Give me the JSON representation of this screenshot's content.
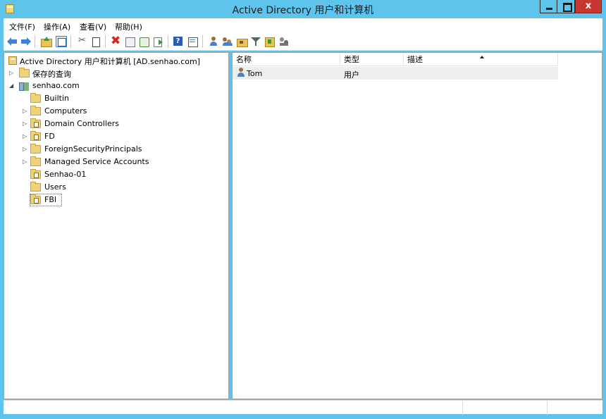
{
  "window": {
    "title": "Active Directory 用户和计算机",
    "close_glyph": "x"
  },
  "menu": {
    "items": [
      "文件(F)",
      "操作(A)",
      "查看(V)",
      "帮助(H)"
    ]
  },
  "toolbar": {
    "icons": [
      "back-icon",
      "forward-icon",
      "up-folder-icon",
      "show-tree-icon",
      "cut-icon",
      "copy-icon",
      "delete-icon",
      "properties-icon",
      "refresh-icon",
      "export-list-icon",
      "help-icon",
      "action-pane-icon",
      "new-user-icon",
      "new-group-icon",
      "new-ou-icon",
      "filter-icon",
      "add-to-group-icon",
      "delegate-control-icon"
    ]
  },
  "tree": {
    "root": "Active Directory 用户和计算机 [AD.senhao.com]",
    "saved_queries": "保存的查询",
    "domain": "senhao.com",
    "children": [
      "Builtin",
      "Computers",
      "Domain Controllers",
      "FD",
      "ForeignSecurityPrincipals",
      "Managed Service Accounts",
      "Senhao-01",
      "Users",
      "FBI"
    ],
    "selected": "FBI"
  },
  "list": {
    "columns": [
      "名称",
      "类型",
      "描述"
    ],
    "sort_column": "描述",
    "rows": [
      {
        "name": "Tom",
        "type": "用户",
        "description": "",
        "icon": "user-icon"
      }
    ]
  },
  "colors": {
    "title_bar": "#5ec4ec",
    "close_button": "#c7372f",
    "row_highlight": "#eeeeee"
  }
}
